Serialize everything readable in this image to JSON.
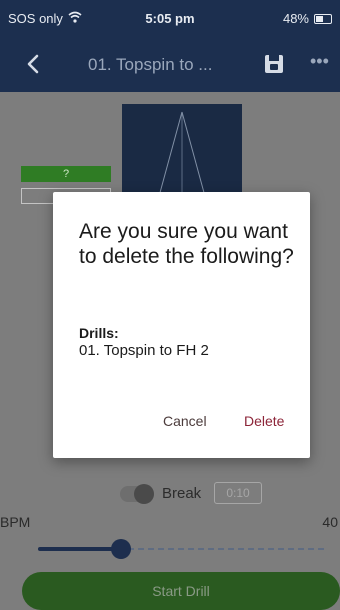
{
  "status_bar": {
    "carrier": "SOS only",
    "time": "5:05 pm",
    "battery": "48%",
    "battery_level": 0.48
  },
  "header": {
    "title": "01. Topspin to ..."
  },
  "background": {
    "green_tag": "?",
    "break_label": "Break",
    "break_value": "0:10",
    "bpm_label": "BPM",
    "bpm_value": "40",
    "bpm_slider_fraction": 0.29,
    "start_button": "Start Drill"
  },
  "dialog": {
    "title": "Are you sure you want to delete the following?",
    "heading": "Drills:",
    "item": "01. Topspin to FH 2",
    "cancel_label": "Cancel",
    "delete_label": "Delete"
  },
  "icons": {
    "wifi": "wifi-icon",
    "battery": "battery-icon",
    "back": "chevron-left-icon",
    "save": "save-icon",
    "more": "more-icon"
  },
  "colors": {
    "header_bg": "#1c2f4f",
    "overlay": "#7d7d7d",
    "delete": "#8c2438"
  }
}
